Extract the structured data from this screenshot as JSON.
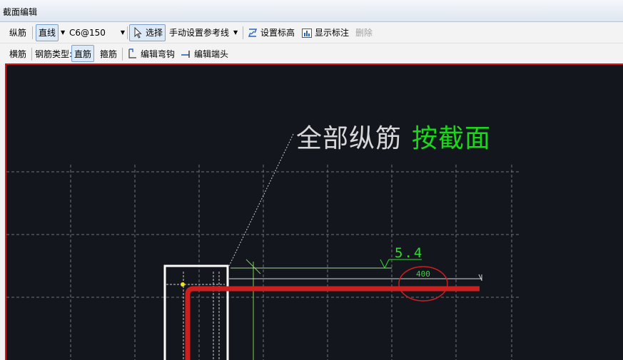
{
  "window": {
    "title": "截面编辑"
  },
  "toolbar1": {
    "tab_longitudinal": "纵筋",
    "line_type": "直线",
    "rebar_spec": "C6@150",
    "select_label": "选择",
    "manual_refline": "手动设置参考线",
    "set_elevation": "设置标高",
    "show_annotation": "显示标注",
    "delete": "删除"
  },
  "toolbar2": {
    "tab_transverse": "横筋",
    "rebar_type_label": "钢筋类型:",
    "straight": "直筋",
    "stirrup": "箍筋",
    "edit_hook": "编辑弯钩",
    "edit_end": "编辑端头"
  },
  "canvas": {
    "annotation_main": "全部纵筋",
    "annotation_mode": "按截面",
    "dimension_value": "5.4",
    "length_value": "400",
    "colors": {
      "background": "#14161e",
      "rebar": "#cc1f1f",
      "dimension": "#2fdc2f",
      "highlight_circle": "#cc1f1f",
      "outline": "#ffffff"
    }
  }
}
